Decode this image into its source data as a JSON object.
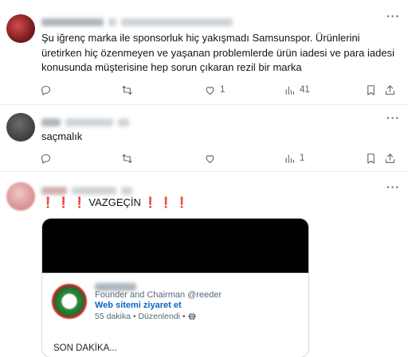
{
  "tweets": [
    {
      "text": "Şu iğrenç marka ile sponsorluk hiç yakışmadı Samsunspor. Ürünlerini üretirken hiç özenmeyen ve yaşanan problemlerde ürün iadesi ve para iadesi konusunda müşterisine hep sorun çıkaran rezil bir marka",
      "likes": "1",
      "views": "41",
      "more": "···"
    },
    {
      "text": "saçmalık",
      "likes": "",
      "views": "1",
      "more": "···"
    },
    {
      "text": "❗ ❗ ❗ VAZGEÇİN ❗ ❗ ❗",
      "more": "···",
      "embed": {
        "role": "Founder and Chairman @reeder",
        "link": "Web sitemi ziyaret et",
        "meta": "55 dakika • Düzenlendi •",
        "body": "SON DAKİKA..."
      }
    }
  ],
  "icons": [
    "reply-icon",
    "retweet-icon",
    "like-icon",
    "views-icon",
    "bookmark-icon",
    "share-icon",
    "globe-icon"
  ]
}
